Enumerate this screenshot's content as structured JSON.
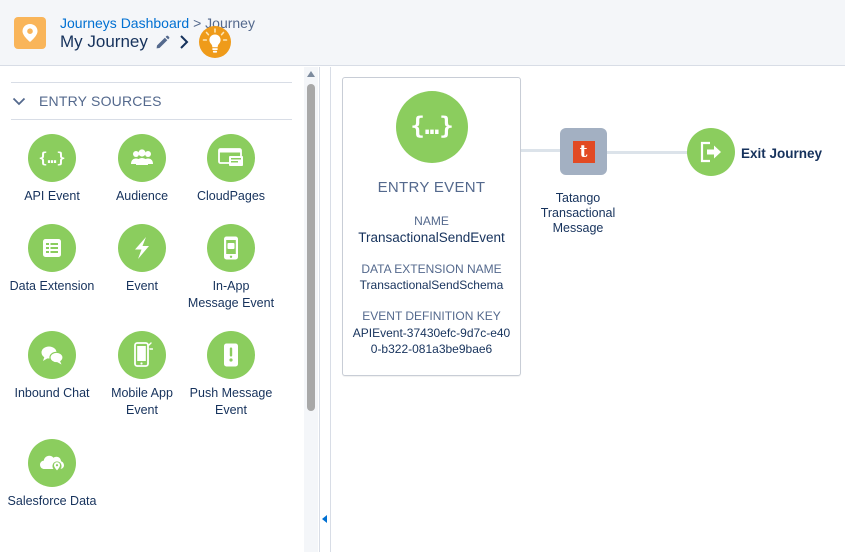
{
  "header": {
    "breadcrumb_link": "Journeys Dashboard",
    "breadcrumb_separator": ">",
    "breadcrumb_current": "Journey",
    "title": "My Journey",
    "app_icon": "map-pin-icon",
    "tips_icon": "lightbulb-icon"
  },
  "sidebar": {
    "section_title": "ENTRY SOURCES",
    "items": [
      {
        "label": "API Event",
        "icon": "api-braces-icon"
      },
      {
        "label": "Audience",
        "icon": "audience-icon"
      },
      {
        "label": "CloudPages",
        "icon": "cloudpages-icon"
      },
      {
        "label": "Data Extension",
        "icon": "data-extension-icon"
      },
      {
        "label": "Event",
        "icon": "event-lightning-icon"
      },
      {
        "label": "In-App Message Event",
        "icon": "in-app-message-icon"
      },
      {
        "label": "Inbound Chat",
        "icon": "chat-bubbles-icon"
      },
      {
        "label": "Mobile App Event",
        "icon": "mobile-app-icon"
      },
      {
        "label": "Push Message Event",
        "icon": "push-message-icon"
      },
      {
        "label": "Salesforce Data",
        "icon": "salesforce-cloud-icon"
      }
    ]
  },
  "canvas": {
    "entry_event": {
      "heading": "ENTRY EVENT",
      "name_label": "NAME",
      "name_value": "TransactionalSendEvent",
      "de_label": "DATA EXTENSION NAME",
      "de_value": "TransactionalSendSchema",
      "edk_label": "EVENT DEFINITION KEY",
      "edk_value": "APIEvent-37430efc-9d7c-e400-b322-081a3be9bae6"
    },
    "activity": {
      "label": "Tatango Transactional Message",
      "logo_letter": "t"
    },
    "exit": {
      "label": "Exit Journey"
    }
  },
  "colors": {
    "accent_green": "#8bcd5e",
    "link_blue": "#0070d2",
    "app_icon_orange": "#f9b55a",
    "tips_orange": "#ef9b1a",
    "tatango_red": "#e24a23",
    "activity_gray": "#a3b0c2"
  }
}
